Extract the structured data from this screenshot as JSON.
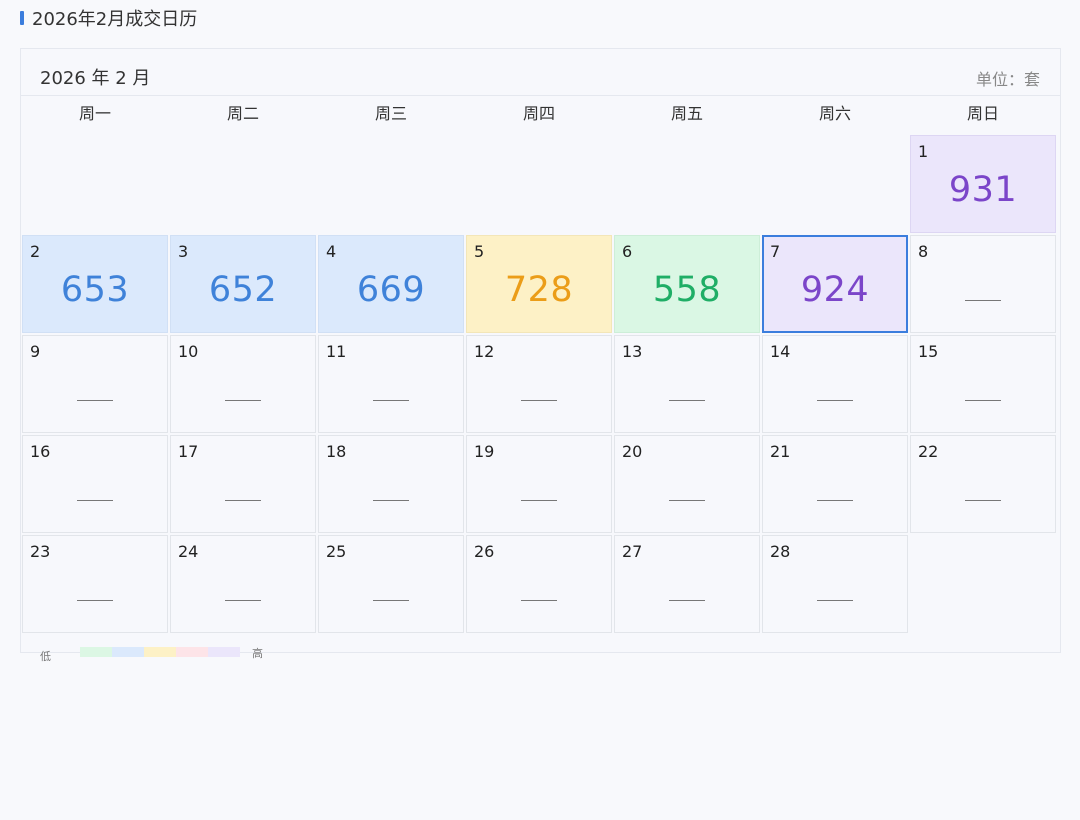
{
  "page_title": "2026年2月成交日历",
  "calendar": {
    "month_label": "2026 年 2 月",
    "unit_label": "单位：套",
    "weekdays": [
      "周一",
      "周二",
      "周三",
      "周四",
      "周五",
      "周六",
      "周日"
    ],
    "days": [
      {
        "day": "1",
        "value": "931",
        "level": "purple"
      },
      {
        "day": "2",
        "value": "653",
        "level": "blue"
      },
      {
        "day": "3",
        "value": "652",
        "level": "blue"
      },
      {
        "day": "4",
        "value": "669",
        "level": "blue"
      },
      {
        "day": "5",
        "value": "728",
        "level": "yellow"
      },
      {
        "day": "6",
        "value": "558",
        "level": "green"
      },
      {
        "day": "7",
        "value": "924",
        "level": "purple",
        "selected": true
      },
      {
        "day": "8"
      },
      {
        "day": "9"
      },
      {
        "day": "10"
      },
      {
        "day": "11"
      },
      {
        "day": "12"
      },
      {
        "day": "13"
      },
      {
        "day": "14"
      },
      {
        "day": "15"
      },
      {
        "day": "16"
      },
      {
        "day": "17"
      },
      {
        "day": "18"
      },
      {
        "day": "19"
      },
      {
        "day": "20"
      },
      {
        "day": "21"
      },
      {
        "day": "22"
      },
      {
        "day": "23"
      },
      {
        "day": "24"
      },
      {
        "day": "25"
      },
      {
        "day": "26"
      },
      {
        "day": "27"
      },
      {
        "day": "28"
      }
    ]
  },
  "legend": {
    "low_label": "低",
    "high_label": "高",
    "colors": [
      "#dcf7e4",
      "#dbe9fc",
      "#fdf1c6",
      "#fde4e8",
      "#ebe6fb"
    ]
  }
}
